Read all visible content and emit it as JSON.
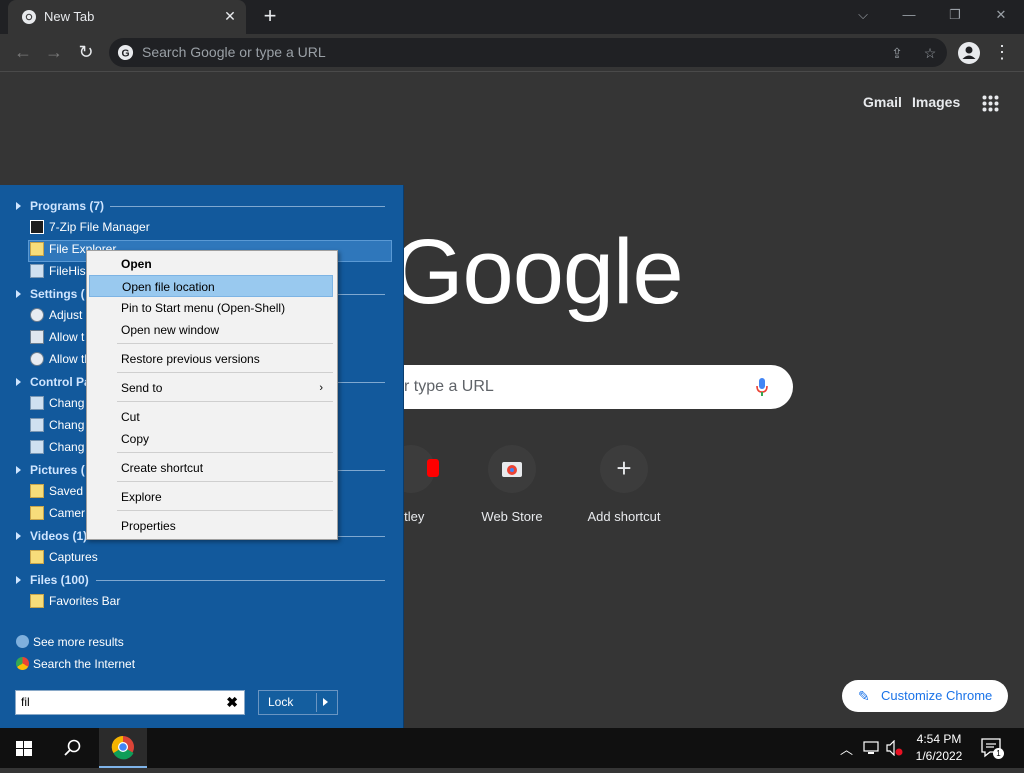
{
  "browser": {
    "tab_title": "New Tab",
    "omnibox_placeholder": "Search Google or type a URL",
    "top_links": {
      "gmail": "Gmail",
      "images": "Images"
    },
    "logo_text": "Google",
    "ntp_search_placeholder": "r type a URL",
    "shortcuts": [
      {
        "label": "stley"
      },
      {
        "label": "Web Store"
      },
      {
        "label": "Add shortcut"
      }
    ],
    "customize_label": "Customize Chrome"
  },
  "start_menu": {
    "sections": {
      "programs": "Programs (7)",
      "settings": "Settings (",
      "control_panel": "Control Pa",
      "pictures": "Pictures (",
      "videos": "Videos (1)",
      "files": "Files (100)"
    },
    "items": {
      "zip": "7-Zip File Manager",
      "file_explorer": "File Explorer",
      "filehis": "FileHis",
      "adjust": "Adjust",
      "allow1": "Allow t",
      "allow2": "Allow th",
      "chang1": "Chang",
      "chang2": "Chang",
      "chang3": "Chang",
      "saved": "Saved",
      "camera": "Camer",
      "captures": "Captures",
      "favorites": "Favorites Bar"
    },
    "see_more": "See more results",
    "search_internet": "Search the Internet",
    "search_value": "fil",
    "lock_label": "Lock"
  },
  "context_menu": {
    "items": {
      "open": "Open",
      "open_file_location": "Open file location",
      "pin": "Pin to Start menu (Open-Shell)",
      "open_new_window": "Open new window",
      "restore": "Restore previous versions",
      "send_to": "Send to",
      "cut": "Cut",
      "copy": "Copy",
      "create_shortcut": "Create shortcut",
      "explore": "Explore",
      "properties": "Properties"
    }
  },
  "taskbar": {
    "time": "4:54 PM",
    "date": "1/6/2022",
    "notification_count": "1"
  },
  "colors": {
    "start_menu_bg": "#12599c",
    "context_highlight": "#99c9ef",
    "ntp_bg": "#353535",
    "accent_blue": "#1a73e8"
  }
}
